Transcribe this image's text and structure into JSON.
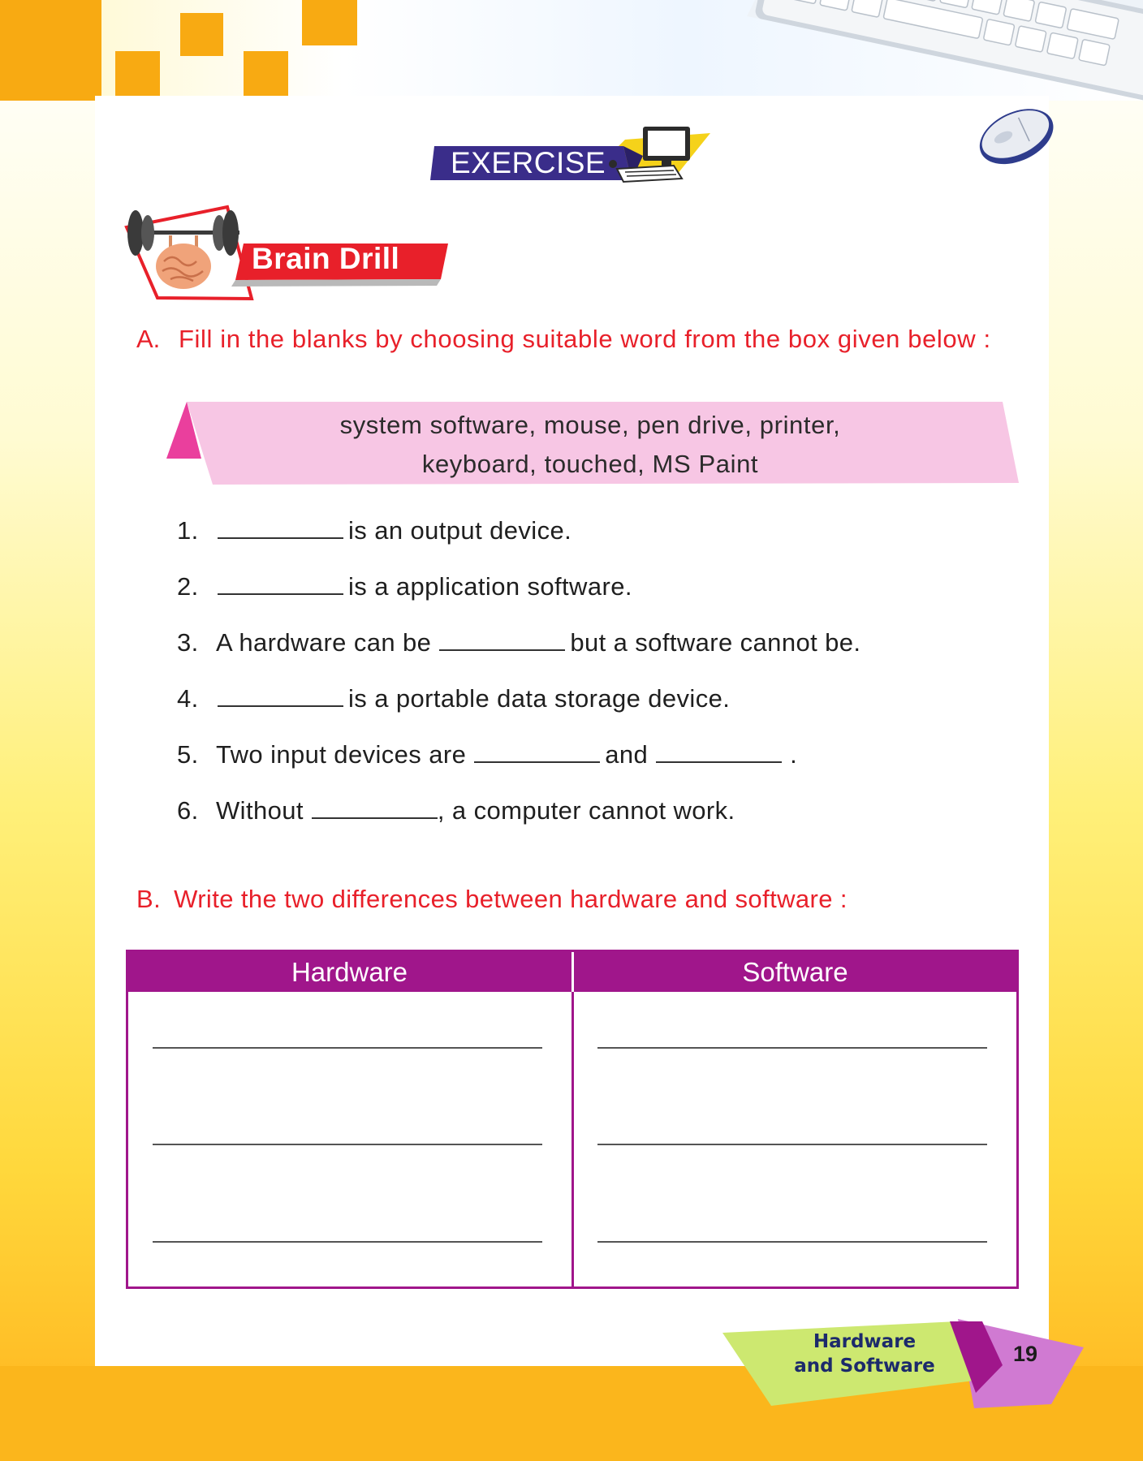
{
  "header": {
    "exercise_label": "EXERCISE"
  },
  "section": {
    "title": "Brain Drill"
  },
  "question_a": {
    "number": "A.",
    "text": "Fill in the blanks by choosing suitable word from the box given below :",
    "word_box_line1": "system software, mouse, pen drive, printer,",
    "word_box_line2": "keyboard, touched, MS Paint",
    "items": [
      {
        "num": "1.",
        "before": "",
        "middle": "is an output device.",
        "after": ""
      },
      {
        "num": "2.",
        "before": "",
        "middle": "is a application software.",
        "after": ""
      },
      {
        "num": "3.",
        "before": "A hardware can be",
        "middle": "but a software cannot be.",
        "after": ""
      },
      {
        "num": "4.",
        "before": "",
        "middle": "is a portable data storage device.",
        "after": ""
      },
      {
        "num": "5.",
        "before": "Two input devices are",
        "middle": "and",
        "after": "."
      },
      {
        "num": "6.",
        "before": "Without",
        "middle": ", a computer cannot work.",
        "after": ""
      }
    ]
  },
  "question_b": {
    "number": "B.",
    "text": "Write the two differences between hardware and software :",
    "col_left": "Hardware",
    "col_right": "Software"
  },
  "footer": {
    "chapter_line1": "Hardware",
    "chapter_line2": "and Software",
    "page_number": "19"
  },
  "colors": {
    "accent_magenta": "#a0168b",
    "question_red": "#e8202a",
    "orange": "#f8aa12"
  }
}
